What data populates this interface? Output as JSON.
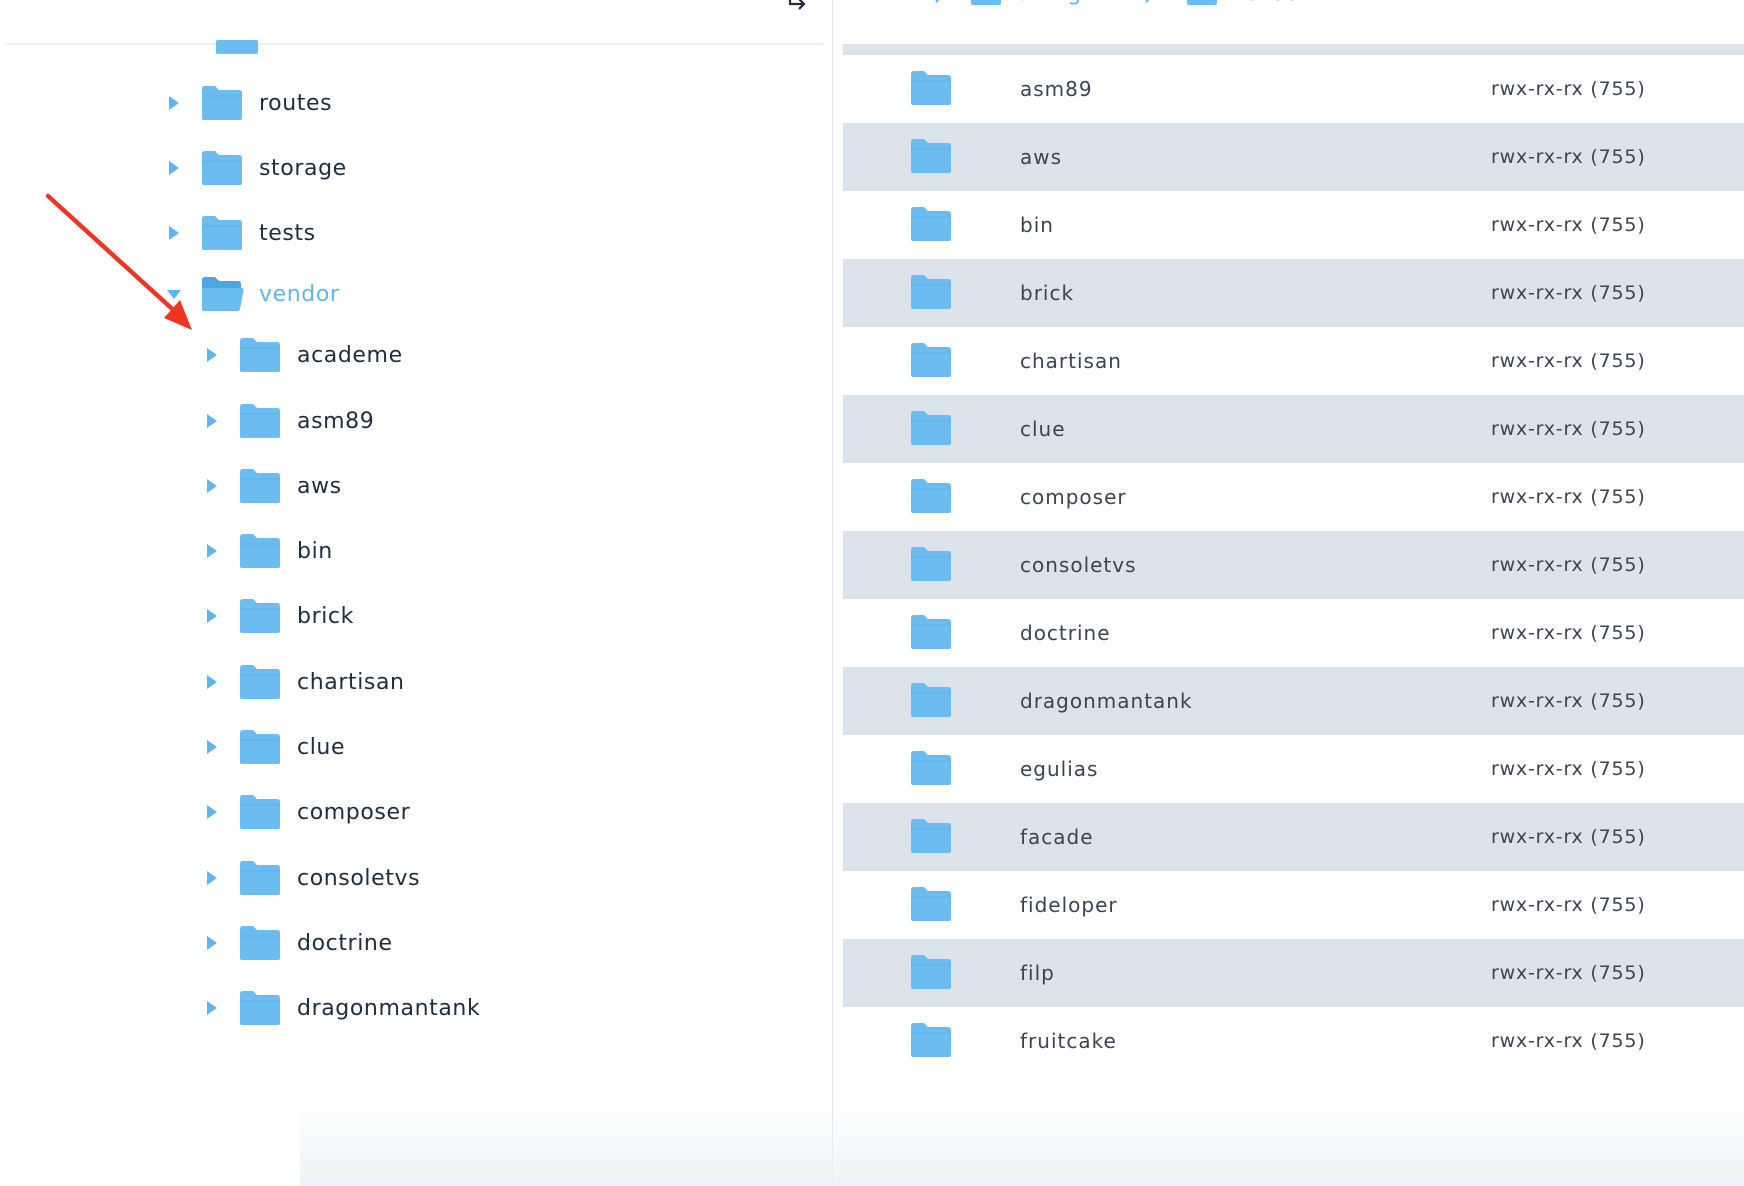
{
  "colors": {
    "accent": "#62b5ec",
    "folder": "#6bbcf1",
    "folder_dark": "#4ea6e0",
    "row_alt": "#dde3eb",
    "arrow_red": "#ee3524"
  },
  "icons": {
    "tree_expand": "triangle-right-icon",
    "tree_collapse": "triangle-down-icon",
    "folder": "folder-icon",
    "folder_open": "folder-open-icon",
    "collapse_panel": "collapse-arrow-icon",
    "breadcrumb_sep": "chevron-right-icon"
  },
  "breadcrumb": {
    "ellipsis": "...",
    "items": [
      "billing",
      "vendor"
    ]
  },
  "tree": {
    "items": [
      {
        "label": "routes",
        "expanded": false,
        "level": 0
      },
      {
        "label": "storage",
        "expanded": false,
        "level": 0
      },
      {
        "label": "tests",
        "expanded": false,
        "level": 0
      },
      {
        "label": "vendor",
        "expanded": true,
        "level": 0
      },
      {
        "label": "academe",
        "expanded": false,
        "level": 1
      },
      {
        "label": "asm89",
        "expanded": false,
        "level": 1
      },
      {
        "label": "aws",
        "expanded": false,
        "level": 1
      },
      {
        "label": "bin",
        "expanded": false,
        "level": 1
      },
      {
        "label": "brick",
        "expanded": false,
        "level": 1
      },
      {
        "label": "chartisan",
        "expanded": false,
        "level": 1
      },
      {
        "label": "clue",
        "expanded": false,
        "level": 1
      },
      {
        "label": "composer",
        "expanded": false,
        "level": 1
      },
      {
        "label": "consoletvs",
        "expanded": false,
        "level": 1
      },
      {
        "label": "doctrine",
        "expanded": false,
        "level": 1
      },
      {
        "label": "dragonmantank",
        "expanded": false,
        "level": 1
      }
    ]
  },
  "files": [
    {
      "name": "asm89",
      "permissions": "rwx-rx-rx (755)"
    },
    {
      "name": "aws",
      "permissions": "rwx-rx-rx (755)"
    },
    {
      "name": "bin",
      "permissions": "rwx-rx-rx (755)"
    },
    {
      "name": "brick",
      "permissions": "rwx-rx-rx (755)"
    },
    {
      "name": "chartisan",
      "permissions": "rwx-rx-rx (755)"
    },
    {
      "name": "clue",
      "permissions": "rwx-rx-rx (755)"
    },
    {
      "name": "composer",
      "permissions": "rwx-rx-rx (755)"
    },
    {
      "name": "consoletvs",
      "permissions": "rwx-rx-rx (755)"
    },
    {
      "name": "doctrine",
      "permissions": "rwx-rx-rx (755)"
    },
    {
      "name": "dragonmantank",
      "permissions": "rwx-rx-rx (755)"
    },
    {
      "name": "egulias",
      "permissions": "rwx-rx-rx (755)"
    },
    {
      "name": "facade",
      "permissions": "rwx-rx-rx (755)"
    },
    {
      "name": "fideloper",
      "permissions": "rwx-rx-rx (755)"
    },
    {
      "name": "filp",
      "permissions": "rwx-rx-rx (755)"
    },
    {
      "name": "fruitcake",
      "permissions": "rwx-rx-rx (755)"
    }
  ]
}
